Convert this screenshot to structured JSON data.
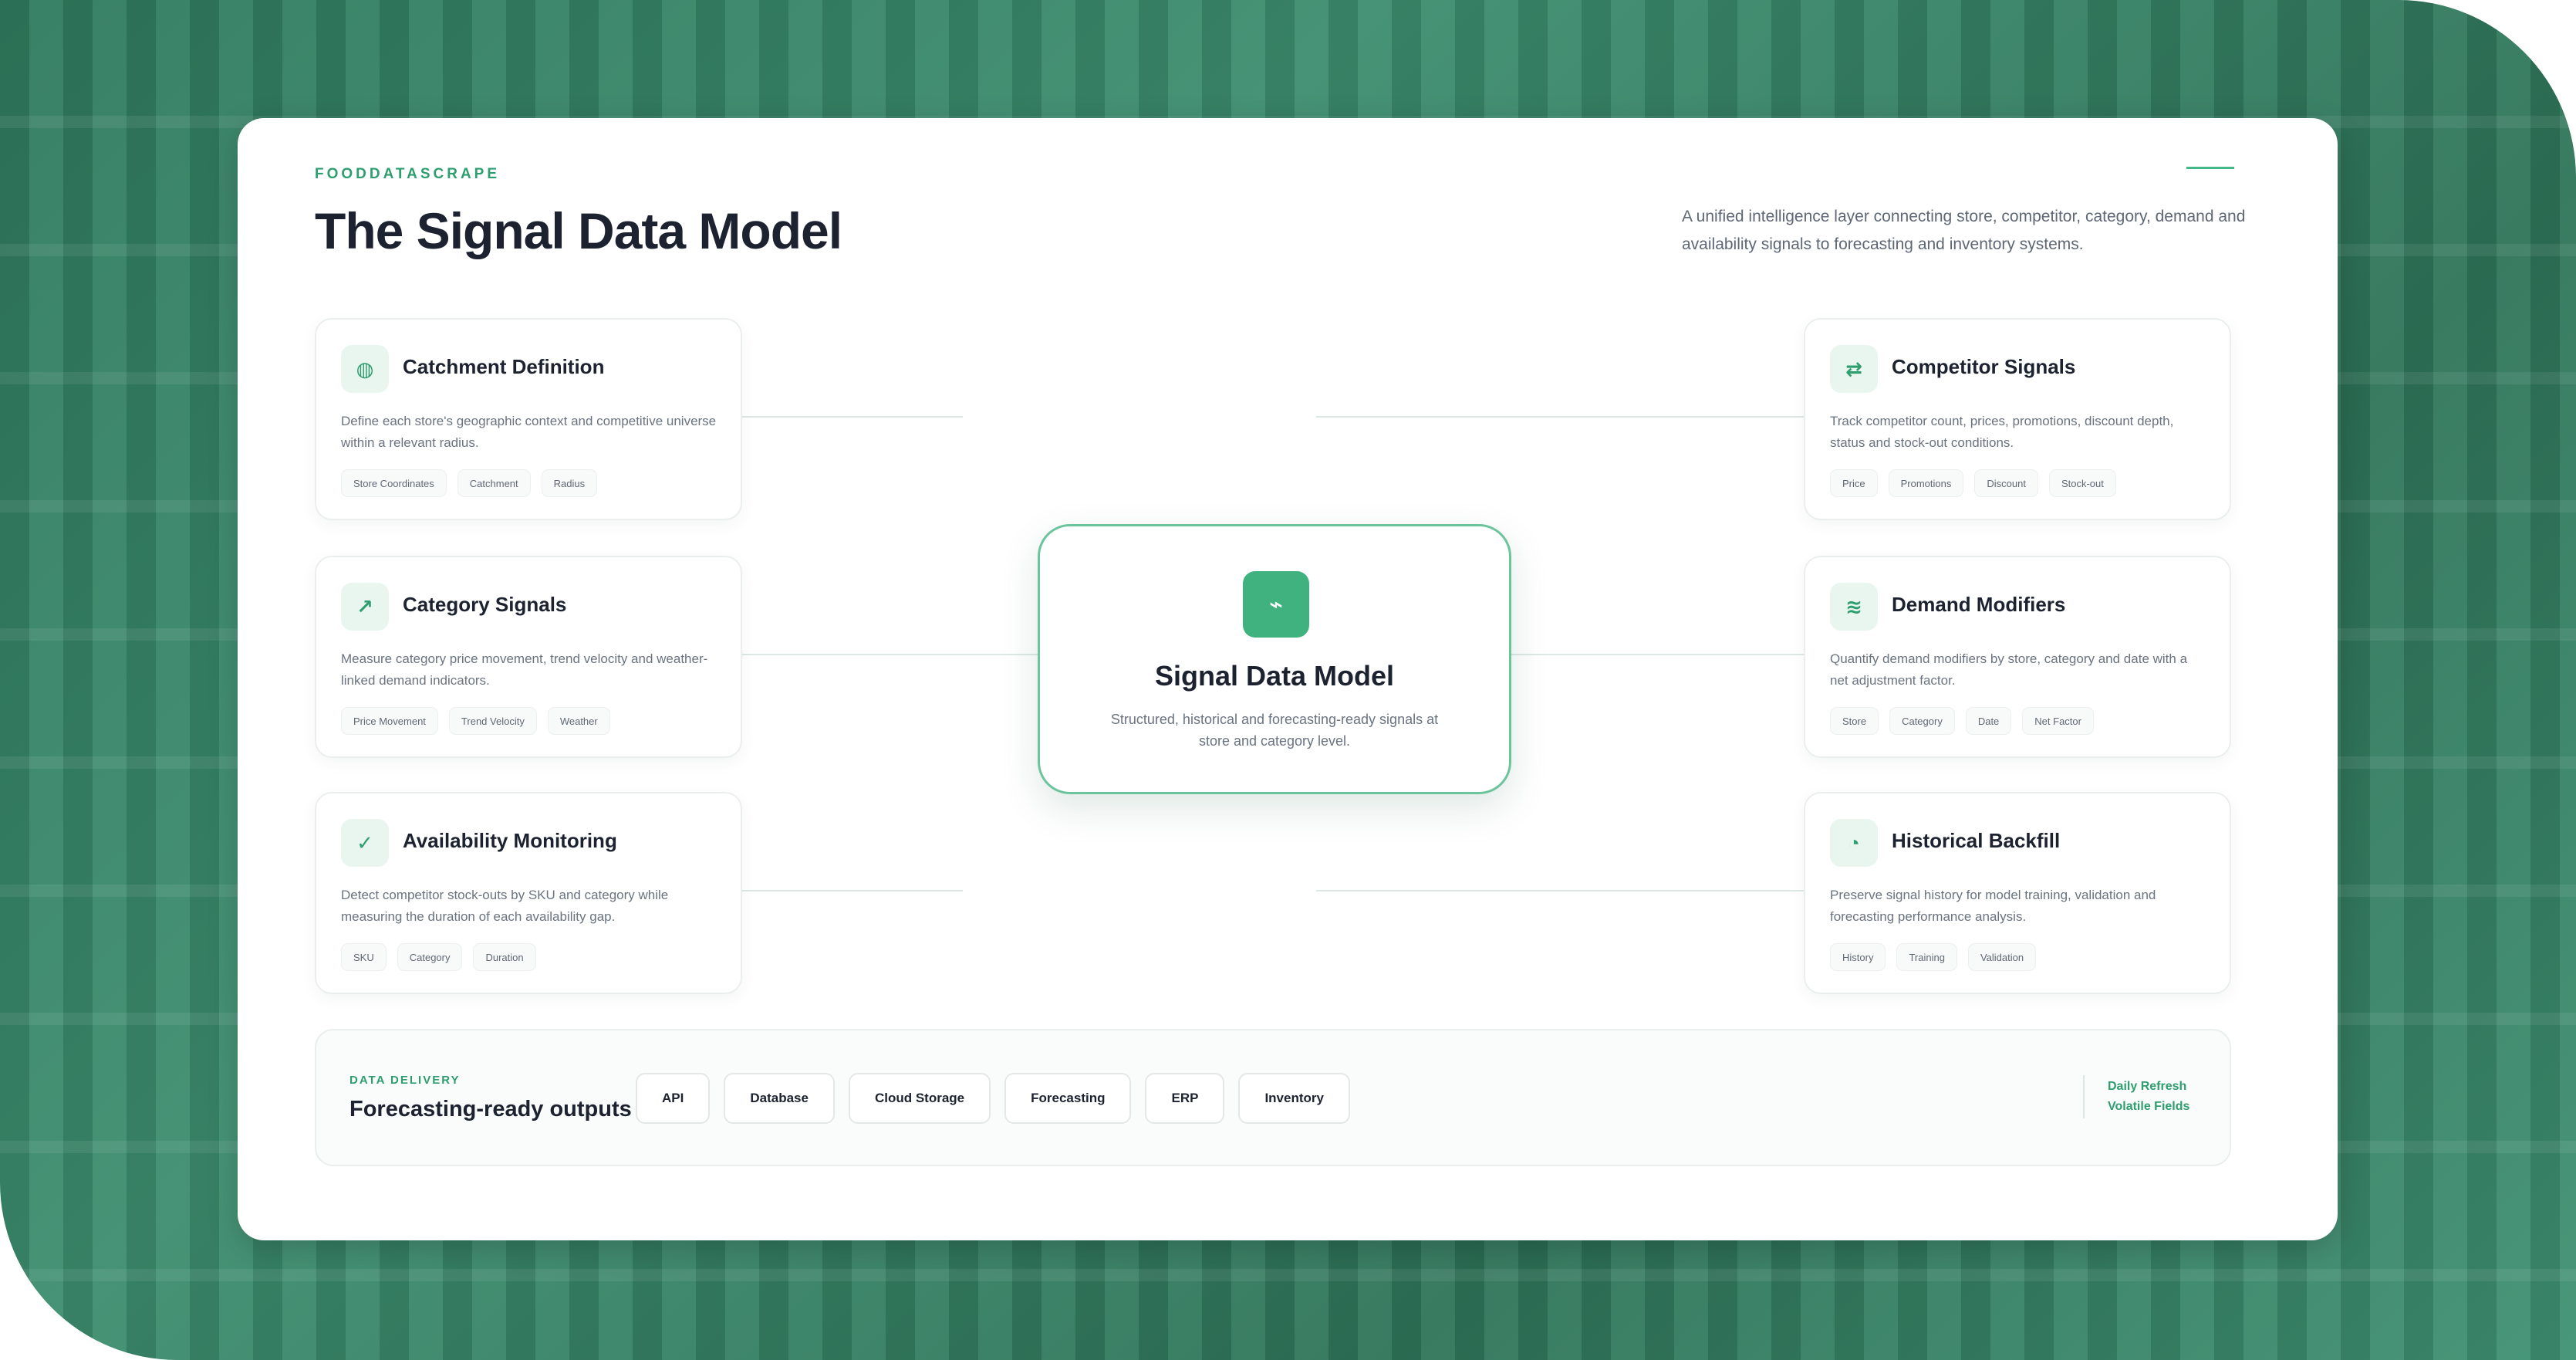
{
  "header": {
    "brand": "FOODDATASCRAPE",
    "title": "The Signal Data Model",
    "subtitle": "A unified intelligence layer connecting store, competitor, category, demand and availability signals to forecasting and inventory systems."
  },
  "hub": {
    "icon": "signal-icon",
    "title": "Signal Data Model",
    "description": "Structured, historical and forecasting-ready signals at store and category level."
  },
  "left_nodes": [
    {
      "icon": "globe-icon",
      "title": "Catchment Definition",
      "description": "Define each store's geographic context and competitive universe within a relevant radius.",
      "tags": [
        "Store Coordinates",
        "Catchment",
        "Radius"
      ]
    },
    {
      "icon": "trend-arrow-icon",
      "title": "Category Signals",
      "description": "Measure category price movement, trend velocity and weather-linked demand indicators.",
      "tags": [
        "Price Movement",
        "Trend Velocity",
        "Weather"
      ]
    },
    {
      "icon": "checkmark-icon",
      "title": "Availability Monitoring",
      "description": "Detect competitor stock-outs by SKU and category while measuring the duration of each availability gap.",
      "tags": [
        "SKU",
        "Category",
        "Duration"
      ]
    }
  ],
  "right_nodes": [
    {
      "icon": "swap-arrows-icon",
      "title": "Competitor Signals",
      "description": "Track competitor count, prices, promotions, discount depth, status and stock-out conditions.",
      "tags": [
        "Price",
        "Promotions",
        "Discount",
        "Stock-out"
      ]
    },
    {
      "icon": "wave-icon",
      "title": "Demand Modifiers",
      "description": "Quantify demand modifiers by store, category and date with a net adjustment factor.",
      "tags": [
        "Store",
        "Category",
        "Date",
        "Net Factor"
      ]
    },
    {
      "icon": "clock-icon",
      "title": "Historical Backfill",
      "description": "Preserve signal history for model training, validation and forecasting performance analysis.",
      "tags": [
        "History",
        "Training",
        "Validation"
      ]
    }
  ],
  "delivery": {
    "label": "DATA DELIVERY",
    "title": "Forecasting-ready outputs",
    "outputs": [
      "API",
      "Database",
      "Cloud Storage",
      "Forecasting",
      "ERP",
      "Inventory"
    ],
    "meta": [
      "Daily Refresh",
      "Volatile Fields"
    ]
  },
  "colors": {
    "accent": "#2e9e6e",
    "hub_icon_bg": "#3fb27f",
    "hub_border": "#6cc49d",
    "backdrop": "#2f7a5e",
    "title_text": "#1c2230"
  },
  "icon_glyphs": {
    "globe-icon": "◍",
    "trend-arrow-icon": "↗",
    "checkmark-icon": "✓",
    "swap-arrows-icon": "⇄",
    "wave-icon": "≋",
    "clock-icon": "◔",
    "signal-icon": "⌁"
  }
}
